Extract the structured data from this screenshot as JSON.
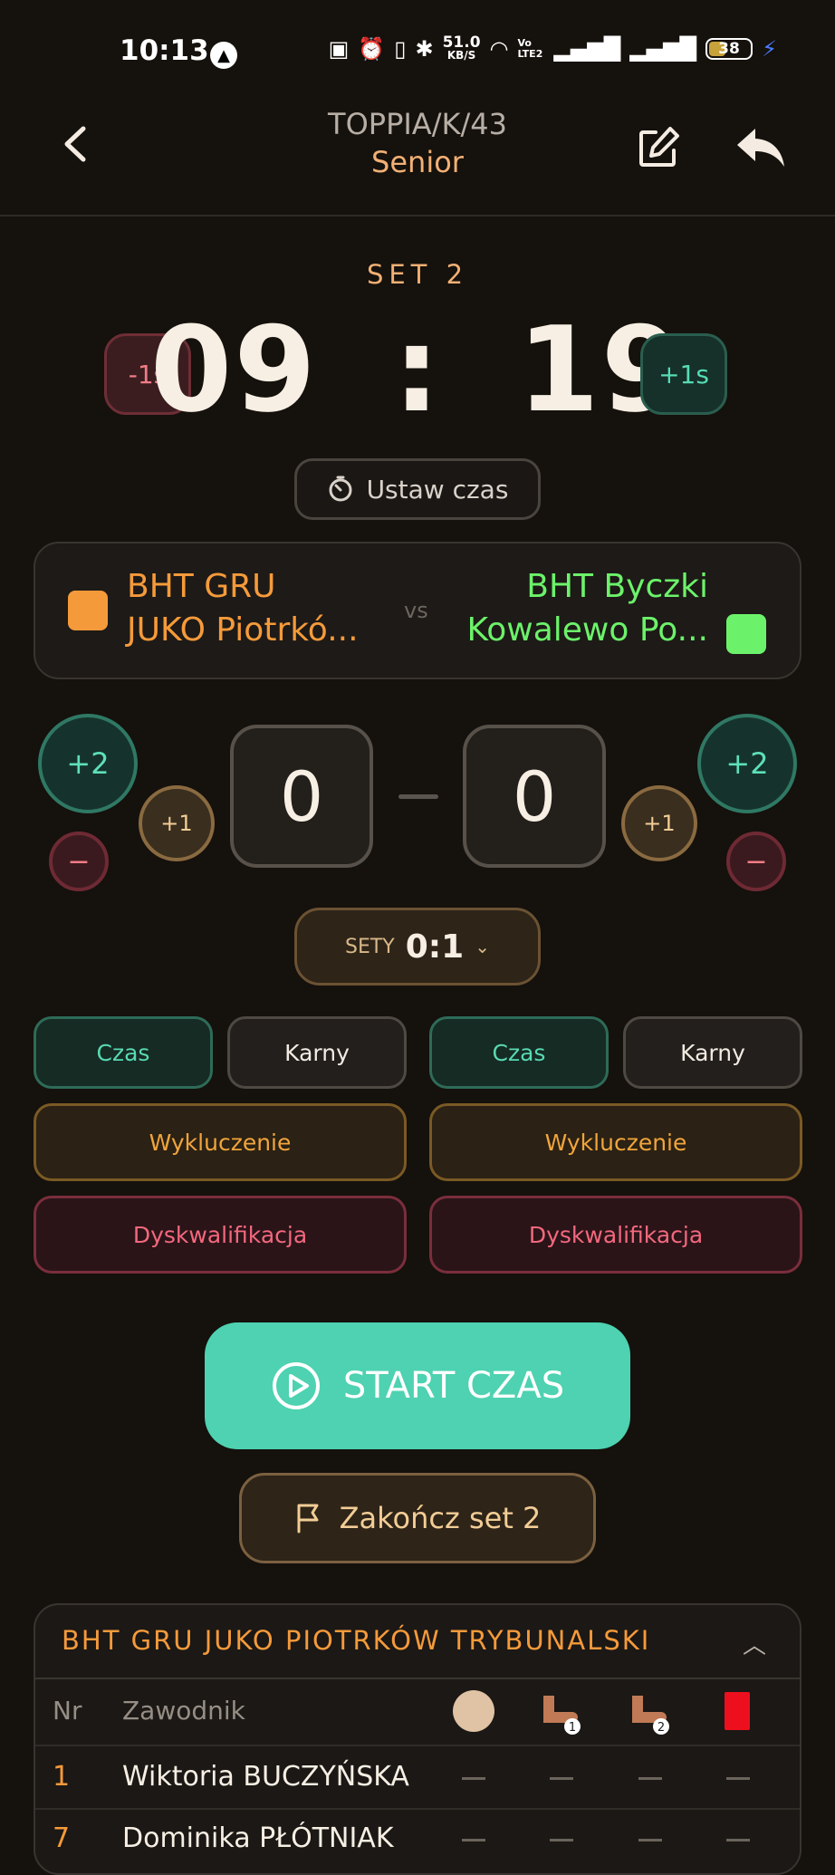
{
  "status_bar": {
    "time": "10:13",
    "network_speed_value": "51.0",
    "network_speed_unit": "KB/S",
    "battery": "38",
    "volte": "Vo LTE2"
  },
  "header": {
    "code": "TOPPIA/K/43",
    "category": "Senior"
  },
  "timer": {
    "set_label": "SET 2",
    "minutes": "09",
    "separator": ":",
    "seconds": "19",
    "minus_label": "-1s",
    "plus_label": "+1s",
    "set_time_label": "Ustaw czas"
  },
  "teams": {
    "home": {
      "line1": "BHT GRU",
      "line2": "JUKO Piotrkó...",
      "color": "#f59a3a"
    },
    "vs": "vs",
    "away": {
      "line1": "BHT Byczki",
      "line2": "Kowalewo Po...",
      "color": "#6cf26a"
    }
  },
  "score": {
    "home": "0",
    "away": "0",
    "plus2": "+2",
    "plus1": "+1",
    "minus": "−",
    "sets_label": "SETY",
    "sets_value": "0:1"
  },
  "actions": {
    "czas": "Czas",
    "karny": "Karny",
    "wykluczenie": "Wykluczenie",
    "dyskwalifikacja": "Dyskwalifikacja"
  },
  "controls": {
    "start": "START CZAS",
    "end_set": "Zakończ set 2"
  },
  "roster": {
    "title": "BHT GRU JUKO PIOTRKÓW TRYBUNALSKI",
    "col_nr": "Nr",
    "col_player": "Zawodnik",
    "col_icons": [
      "ball-icon",
      "suspension-1-icon",
      "suspension-2-icon",
      "red-card-icon"
    ],
    "rows": [
      {
        "nr": "1",
        "name": "Wiktoria BUCZYŃSKA"
      },
      {
        "nr": "7",
        "name": "Dominika PŁÓTNIAK"
      }
    ]
  }
}
